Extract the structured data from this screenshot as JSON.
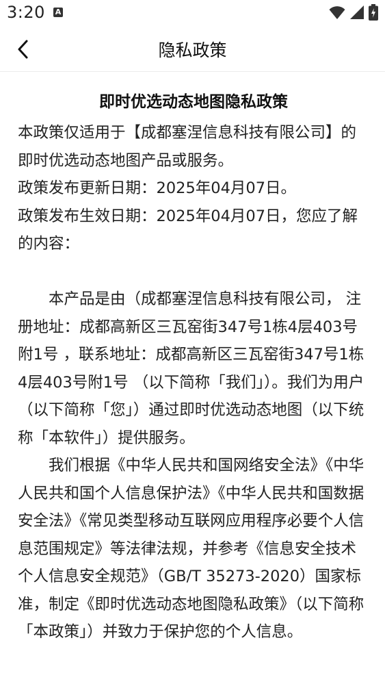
{
  "status_bar": {
    "time": "3:20",
    "notification_badge": "A",
    "icons": [
      "wifi-icon",
      "signal-icon",
      "battery-charging-icon"
    ]
  },
  "nav": {
    "back_icon": "chevron-left-icon",
    "title": "隐私政策"
  },
  "document": {
    "title": "即时优选动态地图隐私政策",
    "paragraphs": [
      "本政策仅适用于【成都塞涅信息科技有限公司】的即时优选动态地图产品或服务。",
      "政策发布更新日期：2025年04月07日。",
      "政策发布生效日期：2025年04月07日，您应了解的内容：",
      "本产品是由（成都塞涅信息科技有限公司， 注册地址：成都高新区三瓦窑街347号1栋4层403号附1号 ，联系地址：成都高新区三瓦窑街347号1栋4层403号附1号 （以下简称「我们」）。我们为用户（以下简称「您」）通过即时优选动态地图（以下统称「本软件」）提供服务。",
      "我们根据《中华人民共和国网络安全法》《中华人民共和国个人信息保护法》《中华人民共和国数据安全法》《常见类型移动互联网应用程序必要个人信息范围规定》等法律法规，并参考《信息安全技术个人信息安全规范》（GB/T 35273-2020）国家标准，制定《即时优选动态地图隐私政策》（以下简称「本政策」）并致力于保护您的个人信息。"
    ]
  }
}
